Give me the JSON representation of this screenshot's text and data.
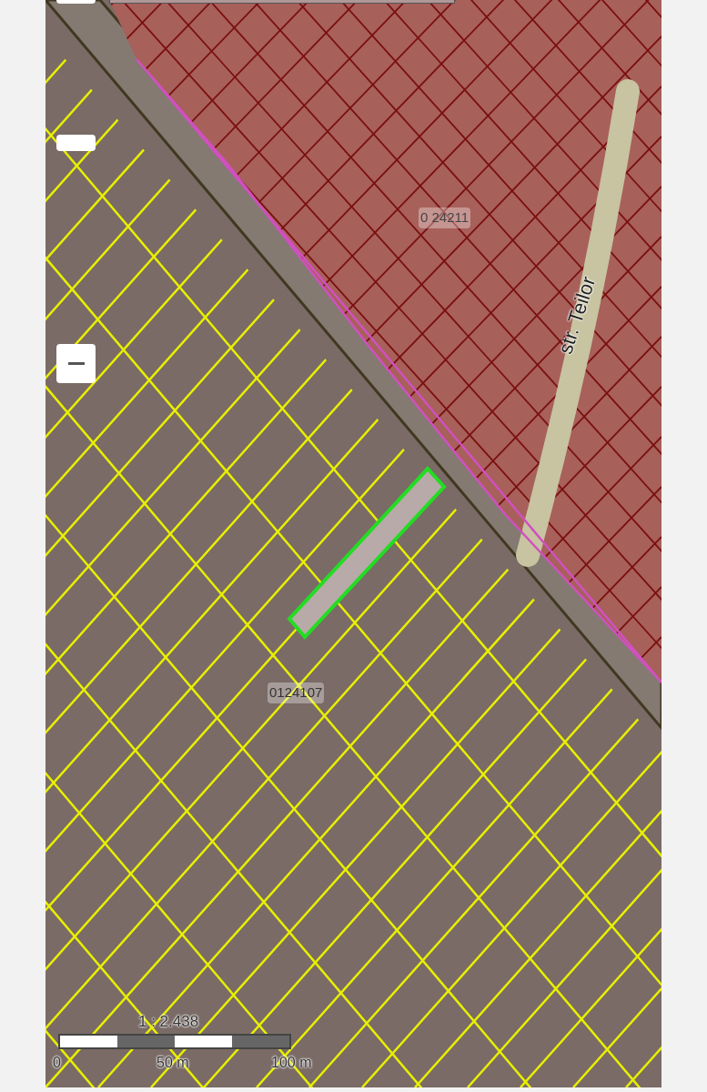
{
  "map": {
    "parcel_labels": [
      "0 24211",
      "0124107"
    ],
    "street_label": "str. Teilor"
  },
  "scale_bar": {
    "ratio": "1 : 2.438",
    "ticks": [
      "0",
      "50 m",
      "100 m"
    ]
  }
}
